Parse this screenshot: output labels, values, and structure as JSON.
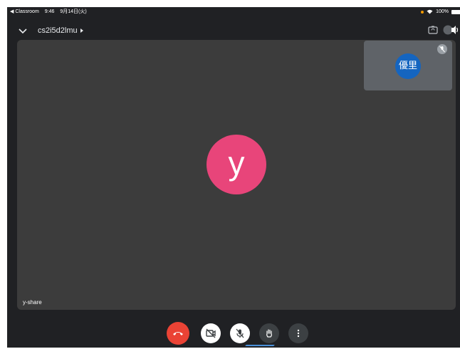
{
  "status_bar": {
    "back_app": "◀ Classroom",
    "time": "9:46",
    "date": "9月14日(火)",
    "battery": "100%",
    "accent": "#f29900"
  },
  "header": {
    "meeting_code": "cs2i5d2lmu",
    "icons": [
      "chevron-down-icon",
      "camera-switch-icon",
      "speaker-icon"
    ]
  },
  "main_participant": {
    "initial": "y",
    "name": "y-share",
    "avatar_color": "#e8457a"
  },
  "self_view": {
    "initial": "優里",
    "avatar_color": "#1565c0",
    "mic_muted": true
  },
  "controls": [
    {
      "name": "end-call",
      "icon": "phone-hangup-icon",
      "color": "#ea4335"
    },
    {
      "name": "camera-toggle",
      "icon": "camera-off-icon",
      "state": "off"
    },
    {
      "name": "mic-toggle",
      "icon": "mic-off-icon",
      "state": "off"
    },
    {
      "name": "raise-hand",
      "icon": "hand-icon"
    },
    {
      "name": "more-options",
      "icon": "more-vert-icon"
    }
  ]
}
